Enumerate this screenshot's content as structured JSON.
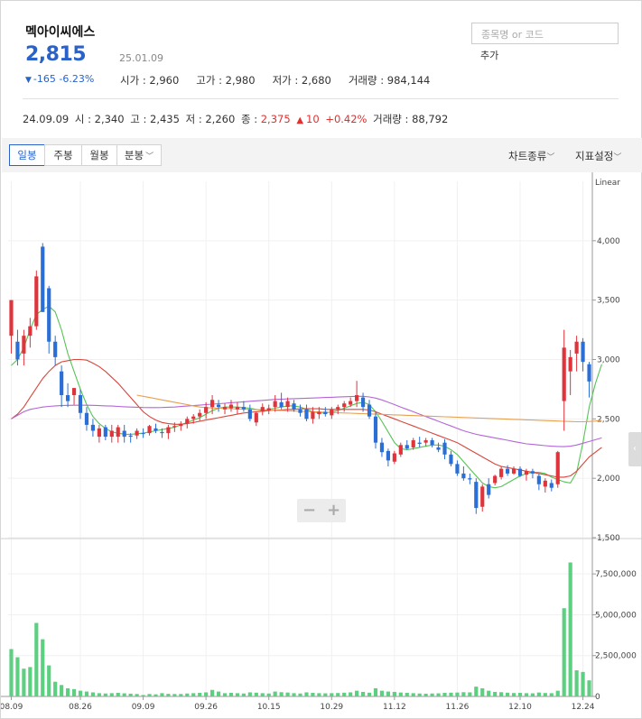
{
  "header": {
    "stock_name": "멕아이씨에스",
    "price": "2,815",
    "date": "25.01.09",
    "change": "-165 -6.23%",
    "change_arrow": "▼",
    "stats": [
      "시가 : 2,960",
      "고가 : 2,980",
      "저가 : 2,680",
      "거래량 : 984,144"
    ],
    "search_placeholder": "종목명 or 코드",
    "add_label": "추가"
  },
  "previous": {
    "date": "24.09.09",
    "open": "시 : 2,340",
    "high": "고 : 2,435",
    "low": "저 : 2,260",
    "close_label": "종 : ",
    "close": "2,375",
    "arrow": "▲",
    "diff": "10",
    "pct": "+0.42%",
    "volume": "거래량 : 88,792"
  },
  "toolbar": {
    "tabs": [
      "일봉",
      "주봉",
      "월봉",
      "분봉"
    ],
    "active_tab": "일봉",
    "chart_type": "차트종류",
    "indicator": "지표설정"
  },
  "colors": {
    "up": "#e0343c",
    "down": "#2a6ed6",
    "ma5": "#55c455",
    "ma20": "#d8463c",
    "ma60": "#b466d8",
    "ma120": "#e8a050",
    "volume": "#5cd080",
    "accent": "#2a62c9"
  },
  "icons": {
    "dropdown": "chevron-down-icon",
    "side": "chevron-left-icon",
    "zoom_out": "minus-icon",
    "zoom_in": "plus-icon"
  },
  "chart_data": {
    "type": "candlestick",
    "scale_label": "Linear",
    "ylim": [
      1500,
      4500
    ],
    "yticks": [
      1500,
      2000,
      2500,
      3000,
      3500,
      4000
    ],
    "ytick_labels": [
      "1,500",
      "2,000",
      "2,500",
      "3,000",
      "3,500",
      "4,000"
    ],
    "volume_ylim": [
      0,
      9000000
    ],
    "volume_ticks": [
      0,
      2500000,
      5000000,
      7500000
    ],
    "volume_tick_labels": [
      "0",
      "2,500,000",
      "5,000,000",
      "7,500,000"
    ],
    "xtick_labels": [
      {
        "label": "08.09",
        "index": 0
      },
      {
        "label": "08.26",
        "index": 11
      },
      {
        "label": "09.09",
        "index": 21
      },
      {
        "label": "09.26",
        "index": 31
      },
      {
        "label": "10.15",
        "index": 41
      },
      {
        "label": "10.29",
        "index": 51
      },
      {
        "label": "11.12",
        "index": 61
      },
      {
        "label": "11.26",
        "index": 71
      },
      {
        "label": "12.10",
        "index": 81
      },
      {
        "label": "12.24",
        "index": 91
      }
    ],
    "candles": [
      {
        "o": 3200,
        "h": 3350,
        "l": 3050,
        "c": 3500,
        "v": 2900000
      },
      {
        "o": 3150,
        "h": 3250,
        "l": 2950,
        "c": 3000,
        "v": 2400000
      },
      {
        "o": 3050,
        "h": 3250,
        "l": 2950,
        "c": 3200,
        "v": 1700000
      },
      {
        "o": 3200,
        "h": 3350,
        "l": 3100,
        "c": 3280,
        "v": 1800000
      },
      {
        "o": 3280,
        "h": 3750,
        "l": 3250,
        "c": 3700,
        "v": 4500000
      },
      {
        "o": 3950,
        "h": 3980,
        "l": 3400,
        "c": 3400,
        "v": 3500000
      },
      {
        "o": 3600,
        "h": 3620,
        "l": 3050,
        "c": 3150,
        "v": 1900000
      },
      {
        "o": 3150,
        "h": 3200,
        "l": 2950,
        "c": 3020,
        "v": 900000
      },
      {
        "o": 2900,
        "h": 2950,
        "l": 2600,
        "c": 2700,
        "v": 700000
      },
      {
        "o": 2700,
        "h": 2800,
        "l": 2600,
        "c": 2650,
        "v": 500000
      },
      {
        "o": 2700,
        "h": 2760,
        "l": 2620,
        "c": 2760,
        "v": 450000
      },
      {
        "o": 2700,
        "h": 2750,
        "l": 2500,
        "c": 2550,
        "v": 350000
      },
      {
        "o": 2550,
        "h": 2600,
        "l": 2400,
        "c": 2450,
        "v": 300000
      },
      {
        "o": 2450,
        "h": 2500,
        "l": 2350,
        "c": 2400,
        "v": 250000
      },
      {
        "o": 2350,
        "h": 2450,
        "l": 2300,
        "c": 2420,
        "v": 200000
      },
      {
        "o": 2430,
        "h": 2450,
        "l": 2320,
        "c": 2350,
        "v": 180000
      },
      {
        "o": 2350,
        "h": 2450,
        "l": 2300,
        "c": 2400,
        "v": 200000
      },
      {
        "o": 2350,
        "h": 2450,
        "l": 2300,
        "c": 2430,
        "v": 220000
      },
      {
        "o": 2400,
        "h": 2450,
        "l": 2300,
        "c": 2350,
        "v": 190000
      },
      {
        "o": 2360,
        "h": 2380,
        "l": 2300,
        "c": 2350,
        "v": 170000
      },
      {
        "o": 2360,
        "h": 2420,
        "l": 2330,
        "c": 2400,
        "v": 150000
      },
      {
        "o": 2380,
        "h": 2420,
        "l": 2340,
        "c": 2375,
        "v": 88792
      },
      {
        "o": 2380,
        "h": 2450,
        "l": 2360,
        "c": 2440,
        "v": 150000
      },
      {
        "o": 2420,
        "h": 2460,
        "l": 2380,
        "c": 2400,
        "v": 130000
      },
      {
        "o": 2390,
        "h": 2420,
        "l": 2340,
        "c": 2380,
        "v": 200000
      },
      {
        "o": 2380,
        "h": 2450,
        "l": 2330,
        "c": 2430,
        "v": 160000
      },
      {
        "o": 2430,
        "h": 2470,
        "l": 2390,
        "c": 2440,
        "v": 150000
      },
      {
        "o": 2440,
        "h": 2480,
        "l": 2400,
        "c": 2460,
        "v": 150000
      },
      {
        "o": 2460,
        "h": 2520,
        "l": 2420,
        "c": 2500,
        "v": 180000
      },
      {
        "o": 2500,
        "h": 2540,
        "l": 2460,
        "c": 2520,
        "v": 200000
      },
      {
        "o": 2520,
        "h": 2580,
        "l": 2480,
        "c": 2550,
        "v": 220000
      },
      {
        "o": 2550,
        "h": 2640,
        "l": 2500,
        "c": 2600,
        "v": 250000
      },
      {
        "o": 2600,
        "h": 2700,
        "l": 2540,
        "c": 2660,
        "v": 400000
      },
      {
        "o": 2620,
        "h": 2660,
        "l": 2560,
        "c": 2600,
        "v": 300000
      },
      {
        "o": 2580,
        "h": 2630,
        "l": 2540,
        "c": 2600,
        "v": 200000
      },
      {
        "o": 2590,
        "h": 2660,
        "l": 2560,
        "c": 2620,
        "v": 220000
      },
      {
        "o": 2580,
        "h": 2640,
        "l": 2540,
        "c": 2600,
        "v": 200000
      },
      {
        "o": 2600,
        "h": 2650,
        "l": 2560,
        "c": 2580,
        "v": 180000
      },
      {
        "o": 2580,
        "h": 2620,
        "l": 2480,
        "c": 2500,
        "v": 250000
      },
      {
        "o": 2470,
        "h": 2560,
        "l": 2440,
        "c": 2550,
        "v": 230000
      },
      {
        "o": 2560,
        "h": 2630,
        "l": 2530,
        "c": 2600,
        "v": 200000
      },
      {
        "o": 2570,
        "h": 2620,
        "l": 2540,
        "c": 2590,
        "v": 180000
      },
      {
        "o": 2600,
        "h": 2700,
        "l": 2560,
        "c": 2650,
        "v": 300000
      },
      {
        "o": 2640,
        "h": 2720,
        "l": 2580,
        "c": 2600,
        "v": 260000
      },
      {
        "o": 2600,
        "h": 2680,
        "l": 2560,
        "c": 2650,
        "v": 240000
      },
      {
        "o": 2630,
        "h": 2660,
        "l": 2560,
        "c": 2580,
        "v": 200000
      },
      {
        "o": 2580,
        "h": 2620,
        "l": 2520,
        "c": 2550,
        "v": 180000
      },
      {
        "o": 2580,
        "h": 2620,
        "l": 2480,
        "c": 2500,
        "v": 250000
      },
      {
        "o": 2500,
        "h": 2600,
        "l": 2460,
        "c": 2560,
        "v": 220000
      },
      {
        "o": 2540,
        "h": 2600,
        "l": 2500,
        "c": 2560,
        "v": 200000
      },
      {
        "o": 2560,
        "h": 2600,
        "l": 2520,
        "c": 2540,
        "v": 190000
      },
      {
        "o": 2530,
        "h": 2600,
        "l": 2500,
        "c": 2580,
        "v": 200000
      },
      {
        "o": 2580,
        "h": 2620,
        "l": 2540,
        "c": 2600,
        "v": 210000
      },
      {
        "o": 2600,
        "h": 2650,
        "l": 2560,
        "c": 2630,
        "v": 230000
      },
      {
        "o": 2620,
        "h": 2680,
        "l": 2600,
        "c": 2650,
        "v": 250000
      },
      {
        "o": 2650,
        "h": 2820,
        "l": 2600,
        "c": 2700,
        "v": 350000
      },
      {
        "o": 2680,
        "h": 2720,
        "l": 2560,
        "c": 2600,
        "v": 280000
      },
      {
        "o": 2620,
        "h": 2660,
        "l": 2500,
        "c": 2520,
        "v": 230000
      },
      {
        "o": 2520,
        "h": 2560,
        "l": 2250,
        "c": 2300,
        "v": 500000
      },
      {
        "o": 2300,
        "h": 2340,
        "l": 2180,
        "c": 2220,
        "v": 350000
      },
      {
        "o": 2230,
        "h": 2250,
        "l": 2100,
        "c": 2150,
        "v": 300000
      },
      {
        "o": 2140,
        "h": 2230,
        "l": 2120,
        "c": 2210,
        "v": 280000
      },
      {
        "o": 2200,
        "h": 2300,
        "l": 2180,
        "c": 2280,
        "v": 240000
      },
      {
        "o": 2280,
        "h": 2320,
        "l": 2240,
        "c": 2250,
        "v": 220000
      },
      {
        "o": 2260,
        "h": 2340,
        "l": 2240,
        "c": 2320,
        "v": 200000
      },
      {
        "o": 2300,
        "h": 2350,
        "l": 2260,
        "c": 2290,
        "v": 180000
      },
      {
        "o": 2300,
        "h": 2340,
        "l": 2270,
        "c": 2320,
        "v": 170000
      },
      {
        "o": 2320,
        "h": 2340,
        "l": 2260,
        "c": 2280,
        "v": 180000
      },
      {
        "o": 2260,
        "h": 2300,
        "l": 2220,
        "c": 2240,
        "v": 190000
      },
      {
        "o": 2300,
        "h": 2330,
        "l": 2160,
        "c": 2200,
        "v": 220000
      },
      {
        "o": 2200,
        "h": 2230,
        "l": 2100,
        "c": 2120,
        "v": 230000
      },
      {
        "o": 2120,
        "h": 2150,
        "l": 2020,
        "c": 2040,
        "v": 240000
      },
      {
        "o": 2040,
        "h": 2100,
        "l": 1980,
        "c": 2000,
        "v": 260000
      },
      {
        "o": 2000,
        "h": 2040,
        "l": 1950,
        "c": 1990,
        "v": 250000
      },
      {
        "o": 1970,
        "h": 2000,
        "l": 1700,
        "c": 1750,
        "v": 600000
      },
      {
        "o": 1760,
        "h": 1950,
        "l": 1720,
        "c": 1930,
        "v": 500000
      },
      {
        "o": 1950,
        "h": 2000,
        "l": 1830,
        "c": 1860,
        "v": 350000
      },
      {
        "o": 1960,
        "h": 2030,
        "l": 1940,
        "c": 2020,
        "v": 280000
      },
      {
        "o": 2010,
        "h": 2100,
        "l": 1990,
        "c": 2080,
        "v": 260000
      },
      {
        "o": 2080,
        "h": 2110,
        "l": 2020,
        "c": 2040,
        "v": 230000
      },
      {
        "o": 2040,
        "h": 2100,
        "l": 2030,
        "c": 2080,
        "v": 210000
      },
      {
        "o": 2080,
        "h": 2100,
        "l": 2010,
        "c": 2020,
        "v": 220000
      },
      {
        "o": 2030,
        "h": 2080,
        "l": 1980,
        "c": 2060,
        "v": 200000
      },
      {
        "o": 2060,
        "h": 2080,
        "l": 2000,
        "c": 2040,
        "v": 190000
      },
      {
        "o": 2020,
        "h": 2040,
        "l": 1900,
        "c": 1950,
        "v": 240000
      },
      {
        "o": 1930,
        "h": 2000,
        "l": 1880,
        "c": 1980,
        "v": 210000
      },
      {
        "o": 1960,
        "h": 1990,
        "l": 1890,
        "c": 1920,
        "v": 200000
      },
      {
        "o": 1950,
        "h": 2230,
        "l": 1920,
        "c": 2220,
        "v": 350000
      },
      {
        "o": 2650,
        "h": 3250,
        "l": 2400,
        "c": 3100,
        "v": 5400000
      },
      {
        "o": 2900,
        "h": 3080,
        "l": 2700,
        "c": 3020,
        "v": 8200000
      },
      {
        "o": 3050,
        "h": 3200,
        "l": 2900,
        "c": 3150,
        "v": 1600000
      },
      {
        "o": 3150,
        "h": 3180,
        "l": 2900,
        "c": 2980,
        "v": 1500000
      },
      {
        "o": 2960,
        "h": 2980,
        "l": 2680,
        "c": 2815,
        "v": 984144
      }
    ],
    "ma_series": [
      {
        "id": "ma5",
        "color": "#55c455",
        "values": [
          2950,
          3000,
          3100,
          3250,
          3380,
          3420,
          3450,
          3400,
          3250,
          3050,
          2900,
          2750,
          2620,
          2520,
          2460,
          2420,
          2390,
          2380,
          2370,
          2370,
          2375,
          2380,
          2390,
          2400,
          2410,
          2420,
          2430,
          2450,
          2470,
          2490,
          2510,
          2540,
          2570,
          2590,
          2600,
          2600,
          2600,
          2595,
          2590,
          2580,
          2570,
          2580,
          2590,
          2600,
          2610,
          2610,
          2600,
          2580,
          2560,
          2550,
          2550,
          2560,
          2570,
          2590,
          2610,
          2630,
          2640,
          2620,
          2560,
          2480,
          2390,
          2300,
          2250,
          2240,
          2250,
          2260,
          2270,
          2280,
          2280,
          2270,
          2240,
          2200,
          2140,
          2080,
          2020,
          1960,
          1930,
          1920,
          1930,
          1960,
          1990,
          2020,
          2040,
          2050,
          2050,
          2040,
          2010,
          1990,
          1970,
          1960,
          2050,
          2300,
          2600,
          2800,
          2960
        ]
      },
      {
        "id": "ma20",
        "color": "#d8463c",
        "values": [
          2500,
          2540,
          2600,
          2680,
          2760,
          2840,
          2900,
          2950,
          2980,
          2990,
          3000,
          3000,
          2995,
          2970,
          2940,
          2900,
          2850,
          2800,
          2740,
          2680,
          2620,
          2560,
          2520,
          2490,
          2470,
          2460,
          2455,
          2455,
          2460,
          2470,
          2480,
          2490,
          2500,
          2510,
          2520,
          2530,
          2540,
          2550,
          2555,
          2560,
          2565,
          2570,
          2575,
          2575,
          2580,
          2580,
          2585,
          2585,
          2585,
          2585,
          2580,
          2580,
          2580,
          2580,
          2580,
          2580,
          2580,
          2575,
          2560,
          2540,
          2520,
          2500,
          2480,
          2460,
          2440,
          2420,
          2400,
          2380,
          2360,
          2340,
          2320,
          2300,
          2270,
          2240,
          2210,
          2180,
          2150,
          2120,
          2100,
          2090,
          2080,
          2070,
          2060,
          2050,
          2040,
          2030,
          2020,
          2010,
          2010,
          2020,
          2060,
          2120,
          2180,
          2220,
          2260
        ]
      },
      {
        "id": "ma60",
        "color": "#b466d8",
        "values": [
          2500,
          2530,
          2560,
          2580,
          2590,
          2600,
          2605,
          2610,
          2612,
          2614,
          2615,
          2615,
          2615,
          2614,
          2612,
          2610,
          2608,
          2605,
          2602,
          2600,
          2598,
          2596,
          2595,
          2595,
          2596,
          2598,
          2600,
          2604,
          2608,
          2612,
          2616,
          2620,
          2624,
          2628,
          2632,
          2636,
          2640,
          2644,
          2648,
          2652,
          2656,
          2660,
          2664,
          2666,
          2668,
          2670,
          2672,
          2674,
          2676,
          2678,
          2680,
          2682,
          2684,
          2686,
          2688,
          2690,
          2690,
          2685,
          2675,
          2660,
          2640,
          2620,
          2600,
          2580,
          2560,
          2540,
          2520,
          2500,
          2480,
          2460,
          2440,
          2420,
          2400,
          2385,
          2370,
          2360,
          2350,
          2340,
          2330,
          2320,
          2310,
          2300,
          2290,
          2285,
          2280,
          2275,
          2270,
          2268,
          2266,
          2270,
          2280,
          2295,
          2310,
          2325,
          2340
        ]
      },
      {
        "id": "ma120",
        "color": "#e8a050",
        "values": [
          null,
          null,
          null,
          null,
          null,
          null,
          null,
          null,
          null,
          null,
          null,
          null,
          null,
          null,
          null,
          null,
          null,
          null,
          null,
          null,
          2700,
          2690,
          2680,
          2670,
          2660,
          2650,
          2640,
          2630,
          2620,
          2610,
          2600,
          2595,
          2592,
          2590,
          2588,
          2586,
          2584,
          2582,
          2580,
          2578,
          2576,
          2574,
          2572,
          2570,
          2568,
          2566,
          2564,
          2562,
          2560,
          2558,
          2556,
          2554,
          2552,
          2550,
          2548,
          2546,
          2544,
          2542,
          2540,
          2538,
          2536,
          2534,
          2532,
          2530,
          2528,
          2526,
          2524,
          2522,
          2520,
          2518,
          2516,
          2514,
          2512,
          2510,
          2508,
          2506,
          2504,
          2502,
          2500,
          2498,
          2496,
          2494,
          2492,
          2490,
          2488,
          2486,
          2484,
          2482,
          2480,
          2478,
          2476,
          2476,
          2478,
          2482,
          2488
        ]
      }
    ]
  }
}
